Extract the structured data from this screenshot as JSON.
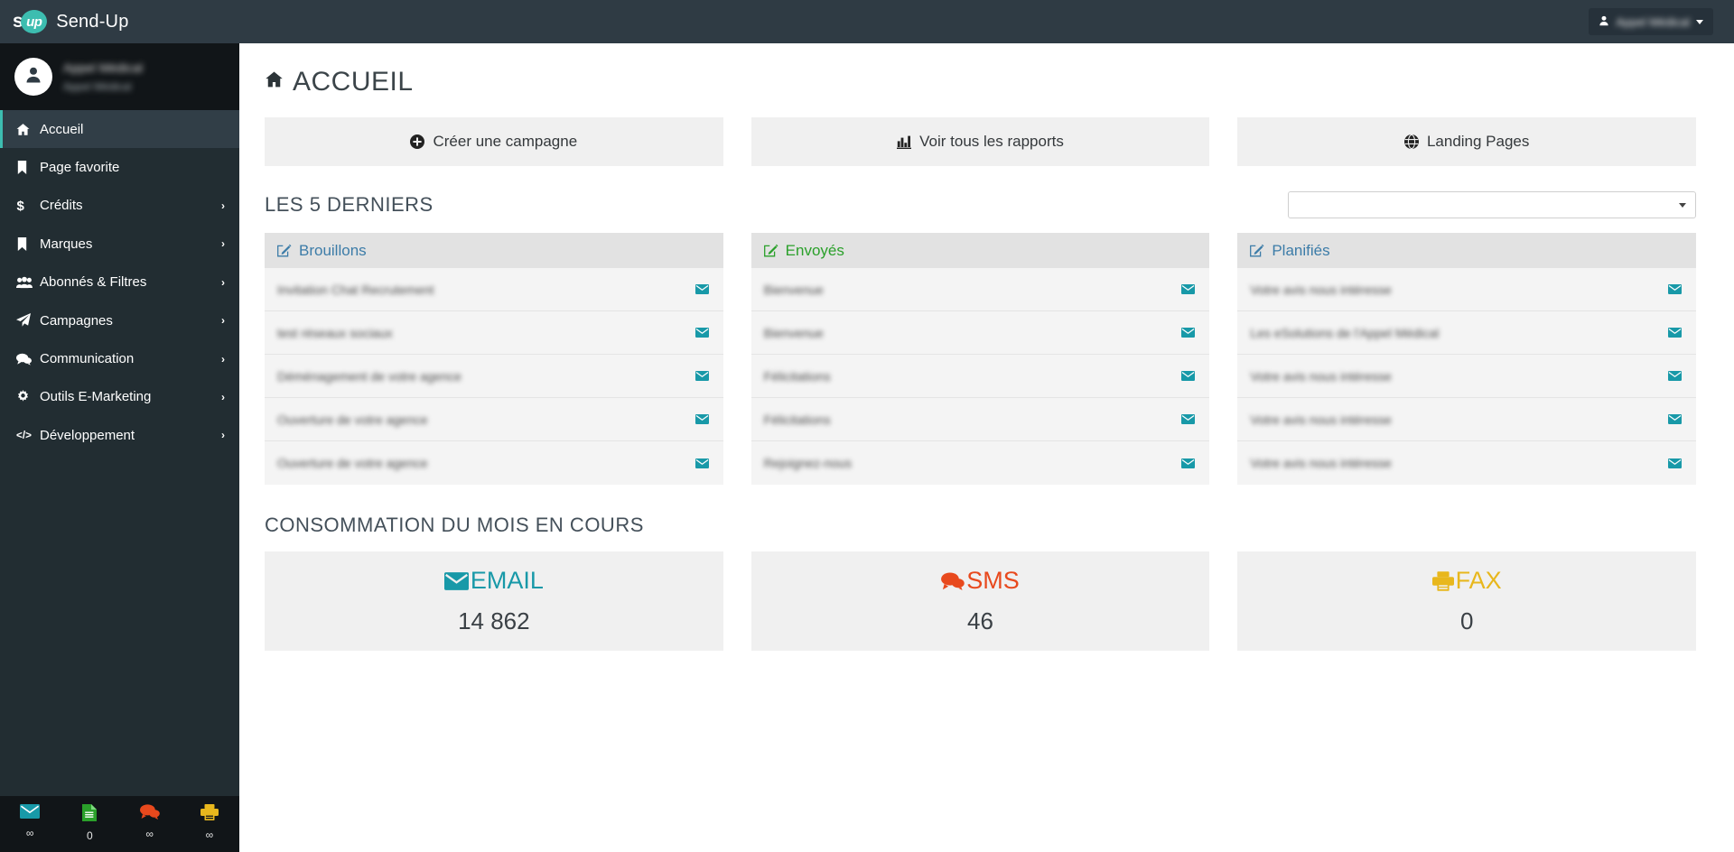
{
  "app": {
    "brand_s": "s",
    "brand_up": "up",
    "title": "Send-Up"
  },
  "topbar": {
    "user_icon": "user-icon",
    "user_name": "Appel Médical",
    "caret_icon": "caret-down-icon"
  },
  "sidebar": {
    "user_panel": {
      "avatar_icon": "avatar-user-icon",
      "name": "Appel Médical",
      "subtitle": "Appel Médical"
    },
    "items": [
      {
        "label": "Accueil",
        "icon": "home-icon",
        "active": true,
        "arrow": ""
      },
      {
        "label": "Page favorite",
        "icon": "bookmark-icon",
        "active": false,
        "arrow": ""
      },
      {
        "label": "Crédits",
        "icon": "dollar-icon",
        "active": false,
        "arrow": "›"
      },
      {
        "label": "Marques",
        "icon": "bookmark-icon",
        "active": false,
        "arrow": "›"
      },
      {
        "label": "Abonnés & Filtres",
        "icon": "users-icon",
        "active": false,
        "arrow": "›"
      },
      {
        "label": "Campagnes",
        "icon": "paper-plane-icon",
        "active": false,
        "arrow": "›"
      },
      {
        "label": "Communication",
        "icon": "comments-icon",
        "active": false,
        "arrow": "›"
      },
      {
        "label": "Outils E-Marketing",
        "icon": "gear-icon",
        "active": false,
        "arrow": "›"
      },
      {
        "label": "Développement",
        "icon": "code-icon",
        "active": false,
        "arrow": "›"
      }
    ],
    "footer": [
      {
        "icon": "envelope-icon",
        "count": "∞",
        "color": "#1899a8"
      },
      {
        "icon": "file-text-icon",
        "count": "0",
        "color": "#2aa02a"
      },
      {
        "icon": "comments-icon",
        "count": "∞",
        "color": "#e8491d"
      },
      {
        "icon": "printer-icon",
        "count": "∞",
        "color": "#e8b71d"
      }
    ]
  },
  "main": {
    "page_title": "ACCUEIL",
    "page_title_icon": "home-icon",
    "actions": [
      {
        "label": "Créer une campagne",
        "icon": "plus-circle-icon"
      },
      {
        "label": "Voir tous les rapports",
        "icon": "bar-chart-icon"
      },
      {
        "label": "Landing Pages",
        "icon": "globe-icon"
      }
    ],
    "latest_section_title": "LES 5 DERNIERS",
    "brand_select": {
      "value": "",
      "placeholder": "",
      "caret_icon": "caret-down-icon"
    },
    "panels": [
      {
        "title": "Brouillons",
        "color": "#3c7ca8",
        "icon": "edit-square-icon",
        "rows": [
          {
            "text": "Invitation Chat Recrutement",
            "icon": "envelope-icon"
          },
          {
            "text": "test réseaux sociaux",
            "icon": "envelope-icon"
          },
          {
            "text": "Déménagement de votre agence",
            "icon": "envelope-icon"
          },
          {
            "text": "Ouverture de votre agence",
            "icon": "envelope-icon"
          },
          {
            "text": "Ouverture de votre agence",
            "icon": "envelope-icon"
          }
        ]
      },
      {
        "title": "Envoyés",
        "color": "#2aa02a",
        "icon": "edit-square-icon",
        "rows": [
          {
            "text": "Bienvenue",
            "icon": "envelope-icon"
          },
          {
            "text": "Bienvenue",
            "icon": "envelope-icon"
          },
          {
            "text": "Félicitations",
            "icon": "envelope-icon"
          },
          {
            "text": "Félicitations",
            "icon": "envelope-icon"
          },
          {
            "text": "Rejoignez-nous",
            "icon": "envelope-icon"
          }
        ]
      },
      {
        "title": "Planifiés",
        "color": "#3c7ca8",
        "icon": "edit-square-icon",
        "rows": [
          {
            "text": "Votre avis nous intéresse",
            "icon": "envelope-icon"
          },
          {
            "text": "Les eSolutions de l'Appel Médical",
            "icon": "envelope-icon"
          },
          {
            "text": "Votre avis nous intéresse",
            "icon": "envelope-icon"
          },
          {
            "text": "Votre avis nous intéresse",
            "icon": "envelope-icon"
          },
          {
            "text": "Votre avis nous intéresse",
            "icon": "envelope-icon"
          }
        ]
      }
    ],
    "consumption_title": "CONSOMMATION DU MOIS EN COURS",
    "consumption_cards": [
      {
        "label": "EMAIL",
        "value": "14 862",
        "color": "#1899a8",
        "icon": "envelope-icon"
      },
      {
        "label": "SMS",
        "value": "46",
        "color": "#e8491d",
        "icon": "comments-icon"
      },
      {
        "label": "FAX",
        "value": "0",
        "color": "#e8b71d",
        "icon": "printer-icon"
      }
    ]
  }
}
